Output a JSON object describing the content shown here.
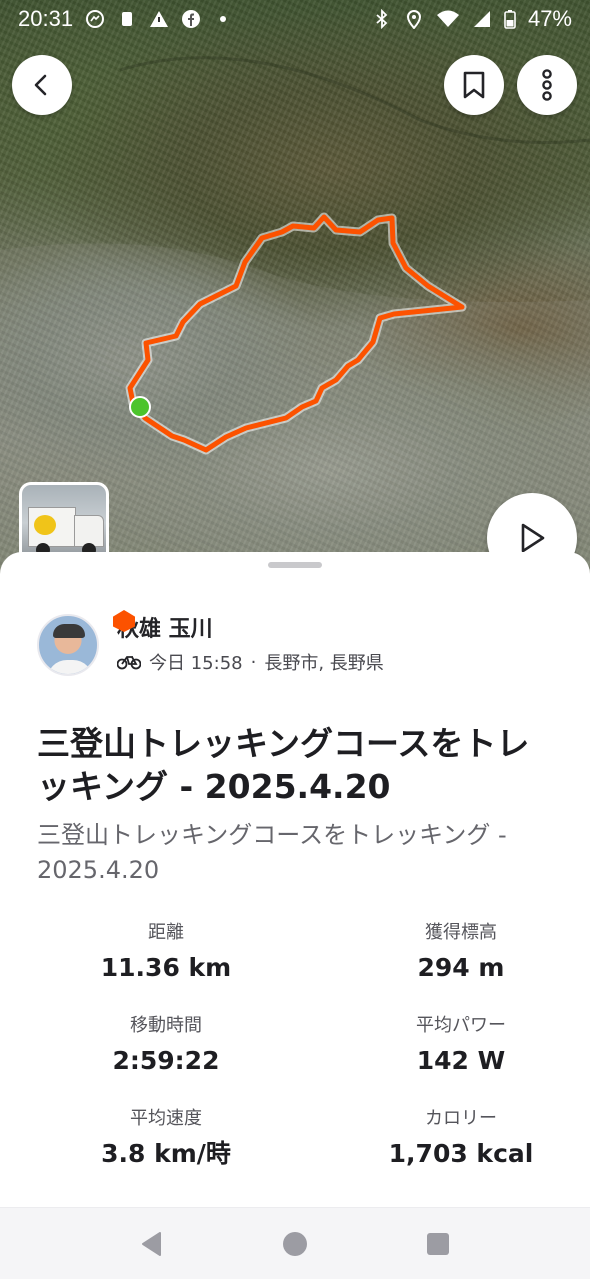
{
  "status_bar": {
    "time": "20:31",
    "battery": "47%",
    "icons_left": [
      "messenger-icon",
      "sim-icon",
      "alert-icon",
      "facebook-icon",
      "dot-icon"
    ],
    "icons_right": [
      "bluetooth-icon",
      "location-icon",
      "wifi-icon",
      "signal-icon",
      "battery-icon"
    ]
  },
  "map": {
    "route_color": "#fc5200",
    "start_marker_color": "#4cc42c"
  },
  "top_bar": {
    "back_icon": "chevron-left-icon",
    "bookmark_icon": "bookmark-icon",
    "more_icon": "vertical-dots-icon"
  },
  "media": {
    "thumbnail": "truck-photo",
    "play_icon": "play-icon"
  },
  "activity": {
    "athlete": {
      "name": "秋雄 玉川",
      "activity_icon": "bike-icon",
      "date_time": "今日 15:58",
      "separator": "·",
      "location": "長野市, 長野県"
    },
    "title": "三登山トレッキングコースをトレッキング - 2025.4.20",
    "description": "三登山トレッキングコースをトレッキング - 2025.4.20",
    "stats": [
      {
        "label": "距離",
        "value": "11.36 km"
      },
      {
        "label": "獲得標高",
        "value": "294 m"
      },
      {
        "label": "移動時間",
        "value": "2:59:22"
      },
      {
        "label": "平均パワー",
        "value": "142 W"
      },
      {
        "label": "平均速度",
        "value": "3.8 km/時"
      },
      {
        "label": "カロリー",
        "value": "1,703 kcal"
      }
    ]
  },
  "nav_bar": {
    "back": "triangle-back-icon",
    "home": "circle-home-icon",
    "recents": "square-recents-icon"
  }
}
